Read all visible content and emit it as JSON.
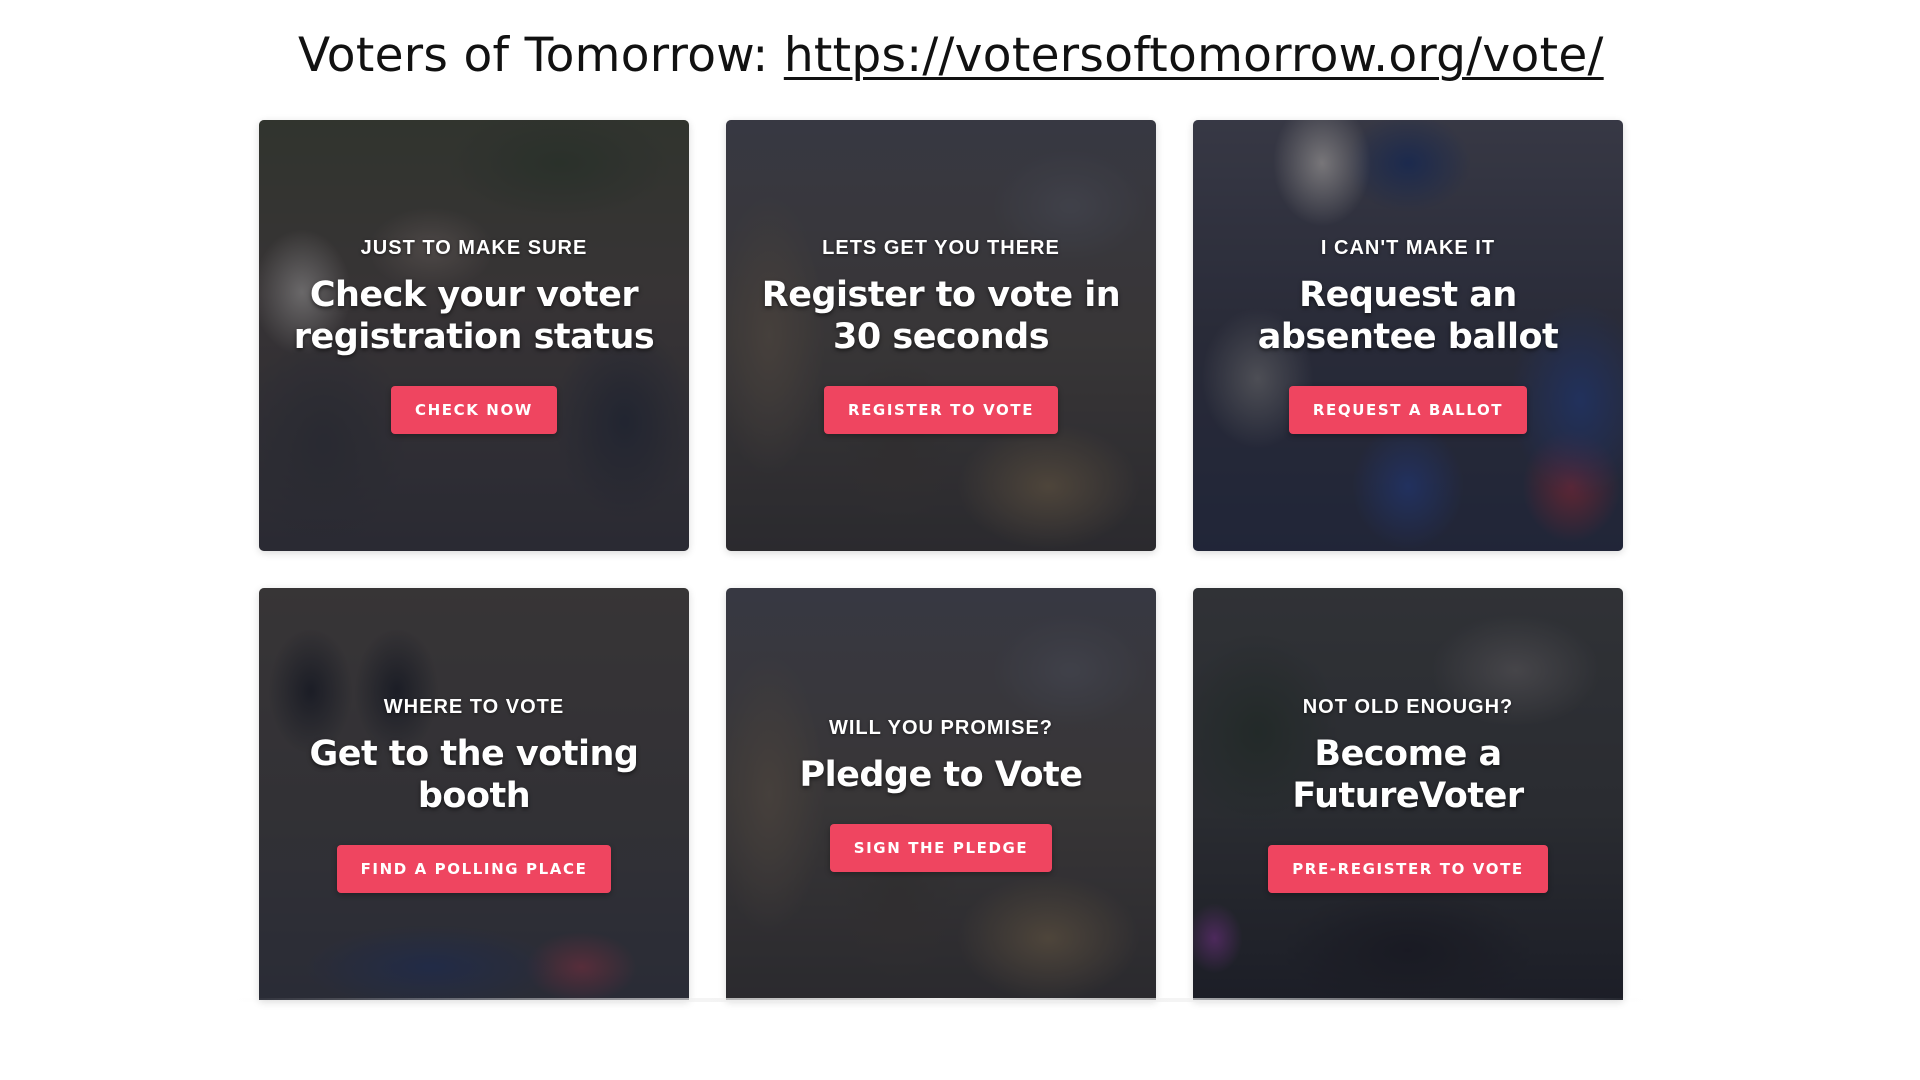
{
  "header": {
    "prefix": "Voters of Tomorrow: ",
    "link": "https://votersoftomorrow.org/vote/"
  },
  "colors": {
    "accent": "#ef4560",
    "overlay": "#1c1e2a"
  },
  "cards": [
    {
      "eyebrow": "JUST TO MAKE SURE",
      "title": "Check your voter registration status",
      "cta": "CHECK NOW"
    },
    {
      "eyebrow": "LETS GET YOU THERE",
      "title": "Register to vote in 30 seconds",
      "cta": "REGISTER TO VOTE"
    },
    {
      "eyebrow": "I CAN'T MAKE IT",
      "title": "Request an absentee ballot",
      "cta": "REQUEST A BALLOT"
    },
    {
      "eyebrow": "WHERE TO VOTE",
      "title": "Get to the voting booth",
      "cta": "FIND A POLLING PLACE"
    },
    {
      "eyebrow": "WILL YOU PROMISE?",
      "title": "Pledge to Vote",
      "cta": "SIGN THE PLEDGE"
    },
    {
      "eyebrow": "NOT OLD ENOUGH?",
      "title": "Become a FutureVoter",
      "cta": "PRE-REGISTER TO VOTE"
    }
  ]
}
